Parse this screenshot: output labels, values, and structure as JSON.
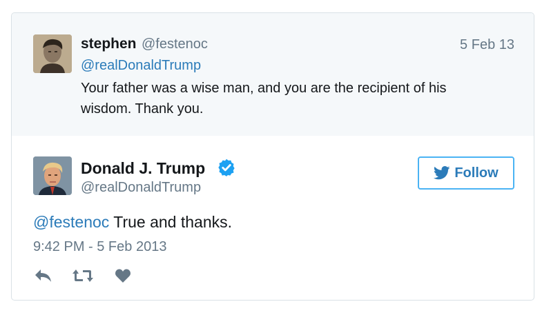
{
  "parent_tweet": {
    "author_name": "stephen",
    "author_handle": "@festenoc",
    "date": "5 Feb 13",
    "mention": "@realDonaldTrump",
    "text": "Your father was a wise man, and you are the recipient of his wisdom. Thank you."
  },
  "tweet": {
    "author_name": "Donald J. Trump",
    "author_handle": "@realDonaldTrump",
    "verified": true,
    "follow_label": "Follow",
    "mention": "@festenoc",
    "text": " True and thanks.",
    "timestamp": "9:42 PM - 5 Feb 2013"
  },
  "actions": [
    {
      "icon": "reply-icon"
    },
    {
      "icon": "retweet-icon"
    },
    {
      "icon": "like-icon"
    }
  ],
  "colors": {
    "link_blue": "#2b7bb9",
    "follow_border": "#4ab3f4",
    "verified_blue": "#1da1f2",
    "secondary_text": "#657786",
    "primary_text": "#14171a",
    "parent_bg": "#f5f8fa",
    "action_icon": "#657786"
  }
}
